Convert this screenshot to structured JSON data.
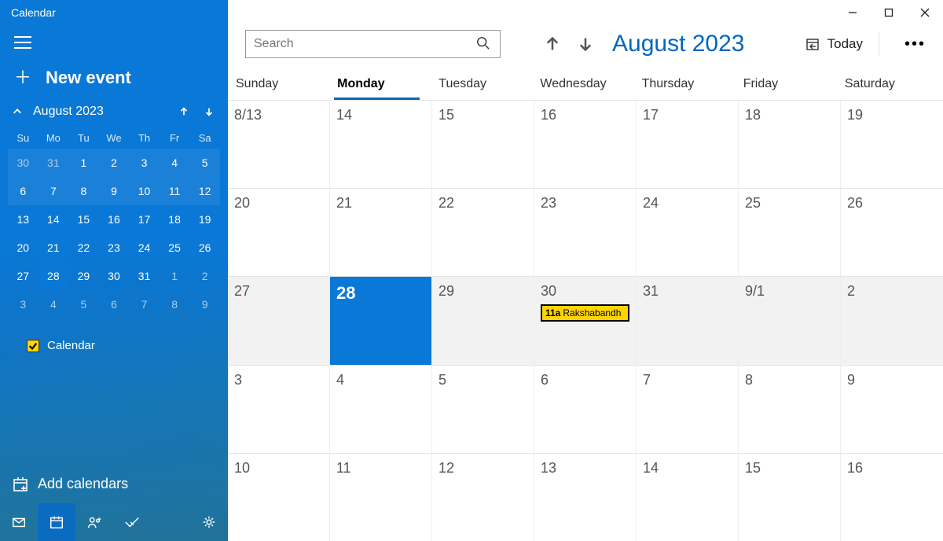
{
  "app_title": "Calendar",
  "sidebar": {
    "new_event": "New event",
    "mini_month": "August 2023",
    "dow": [
      "Su",
      "Mo",
      "Tu",
      "We",
      "Th",
      "Fr",
      "Sa"
    ],
    "weeks": [
      [
        {
          "d": "30",
          "o": true
        },
        {
          "d": "31",
          "o": true
        },
        {
          "d": "1"
        },
        {
          "d": "2"
        },
        {
          "d": "3"
        },
        {
          "d": "4"
        },
        {
          "d": "5"
        }
      ],
      [
        {
          "d": "6"
        },
        {
          "d": "7"
        },
        {
          "d": "8"
        },
        {
          "d": "9"
        },
        {
          "d": "10"
        },
        {
          "d": "11"
        },
        {
          "d": "12"
        }
      ],
      [
        {
          "d": "13"
        },
        {
          "d": "14"
        },
        {
          "d": "15"
        },
        {
          "d": "16"
        },
        {
          "d": "17"
        },
        {
          "d": "18"
        },
        {
          "d": "19"
        }
      ],
      [
        {
          "d": "20"
        },
        {
          "d": "21"
        },
        {
          "d": "22"
        },
        {
          "d": "23"
        },
        {
          "d": "24"
        },
        {
          "d": "25"
        },
        {
          "d": "26"
        }
      ],
      [
        {
          "d": "27"
        },
        {
          "d": "28",
          "sel": true
        },
        {
          "d": "29"
        },
        {
          "d": "30"
        },
        {
          "d": "31"
        },
        {
          "d": "1",
          "o": true
        },
        {
          "d": "2",
          "o": true
        }
      ],
      [
        {
          "d": "3",
          "o": true
        },
        {
          "d": "4",
          "o": true
        },
        {
          "d": "5",
          "o": true
        },
        {
          "d": "6",
          "o": true
        },
        {
          "d": "7",
          "o": true
        },
        {
          "d": "8",
          "o": true
        },
        {
          "d": "9",
          "o": true
        }
      ]
    ],
    "cal_label": "Calendar",
    "add_cal": "Add calendars"
  },
  "toolbar": {
    "search_placeholder": "Search",
    "current_month": "August 2023",
    "today_label": "Today"
  },
  "main": {
    "dow": [
      "Sunday",
      "Monday",
      "Tuesday",
      "Wednesday",
      "Thursday",
      "Friday",
      "Saturday"
    ],
    "active_dow_index": 1,
    "rows": [
      [
        {
          "n": "8/13"
        },
        {
          "n": "14"
        },
        {
          "n": "15"
        },
        {
          "n": "16"
        },
        {
          "n": "17"
        },
        {
          "n": "18"
        },
        {
          "n": "19"
        }
      ],
      [
        {
          "n": "20"
        },
        {
          "n": "21"
        },
        {
          "n": "22"
        },
        {
          "n": "23"
        },
        {
          "n": "24"
        },
        {
          "n": "25"
        },
        {
          "n": "26"
        }
      ],
      [
        {
          "n": "27",
          "shade": true
        },
        {
          "n": "28",
          "sel": true
        },
        {
          "n": "29",
          "shade": true
        },
        {
          "n": "30",
          "shade": true,
          "event": {
            "time": "11a",
            "title": "Rakshabandh"
          }
        },
        {
          "n": "31",
          "shade": true
        },
        {
          "n": "9/1",
          "shade": true
        },
        {
          "n": "2",
          "shade": true
        }
      ],
      [
        {
          "n": "3"
        },
        {
          "n": "4"
        },
        {
          "n": "5"
        },
        {
          "n": "6"
        },
        {
          "n": "7"
        },
        {
          "n": "8"
        },
        {
          "n": "9"
        }
      ],
      [
        {
          "n": "10"
        },
        {
          "n": "11"
        },
        {
          "n": "12"
        },
        {
          "n": "13"
        },
        {
          "n": "14"
        },
        {
          "n": "15"
        },
        {
          "n": "16"
        }
      ]
    ]
  }
}
